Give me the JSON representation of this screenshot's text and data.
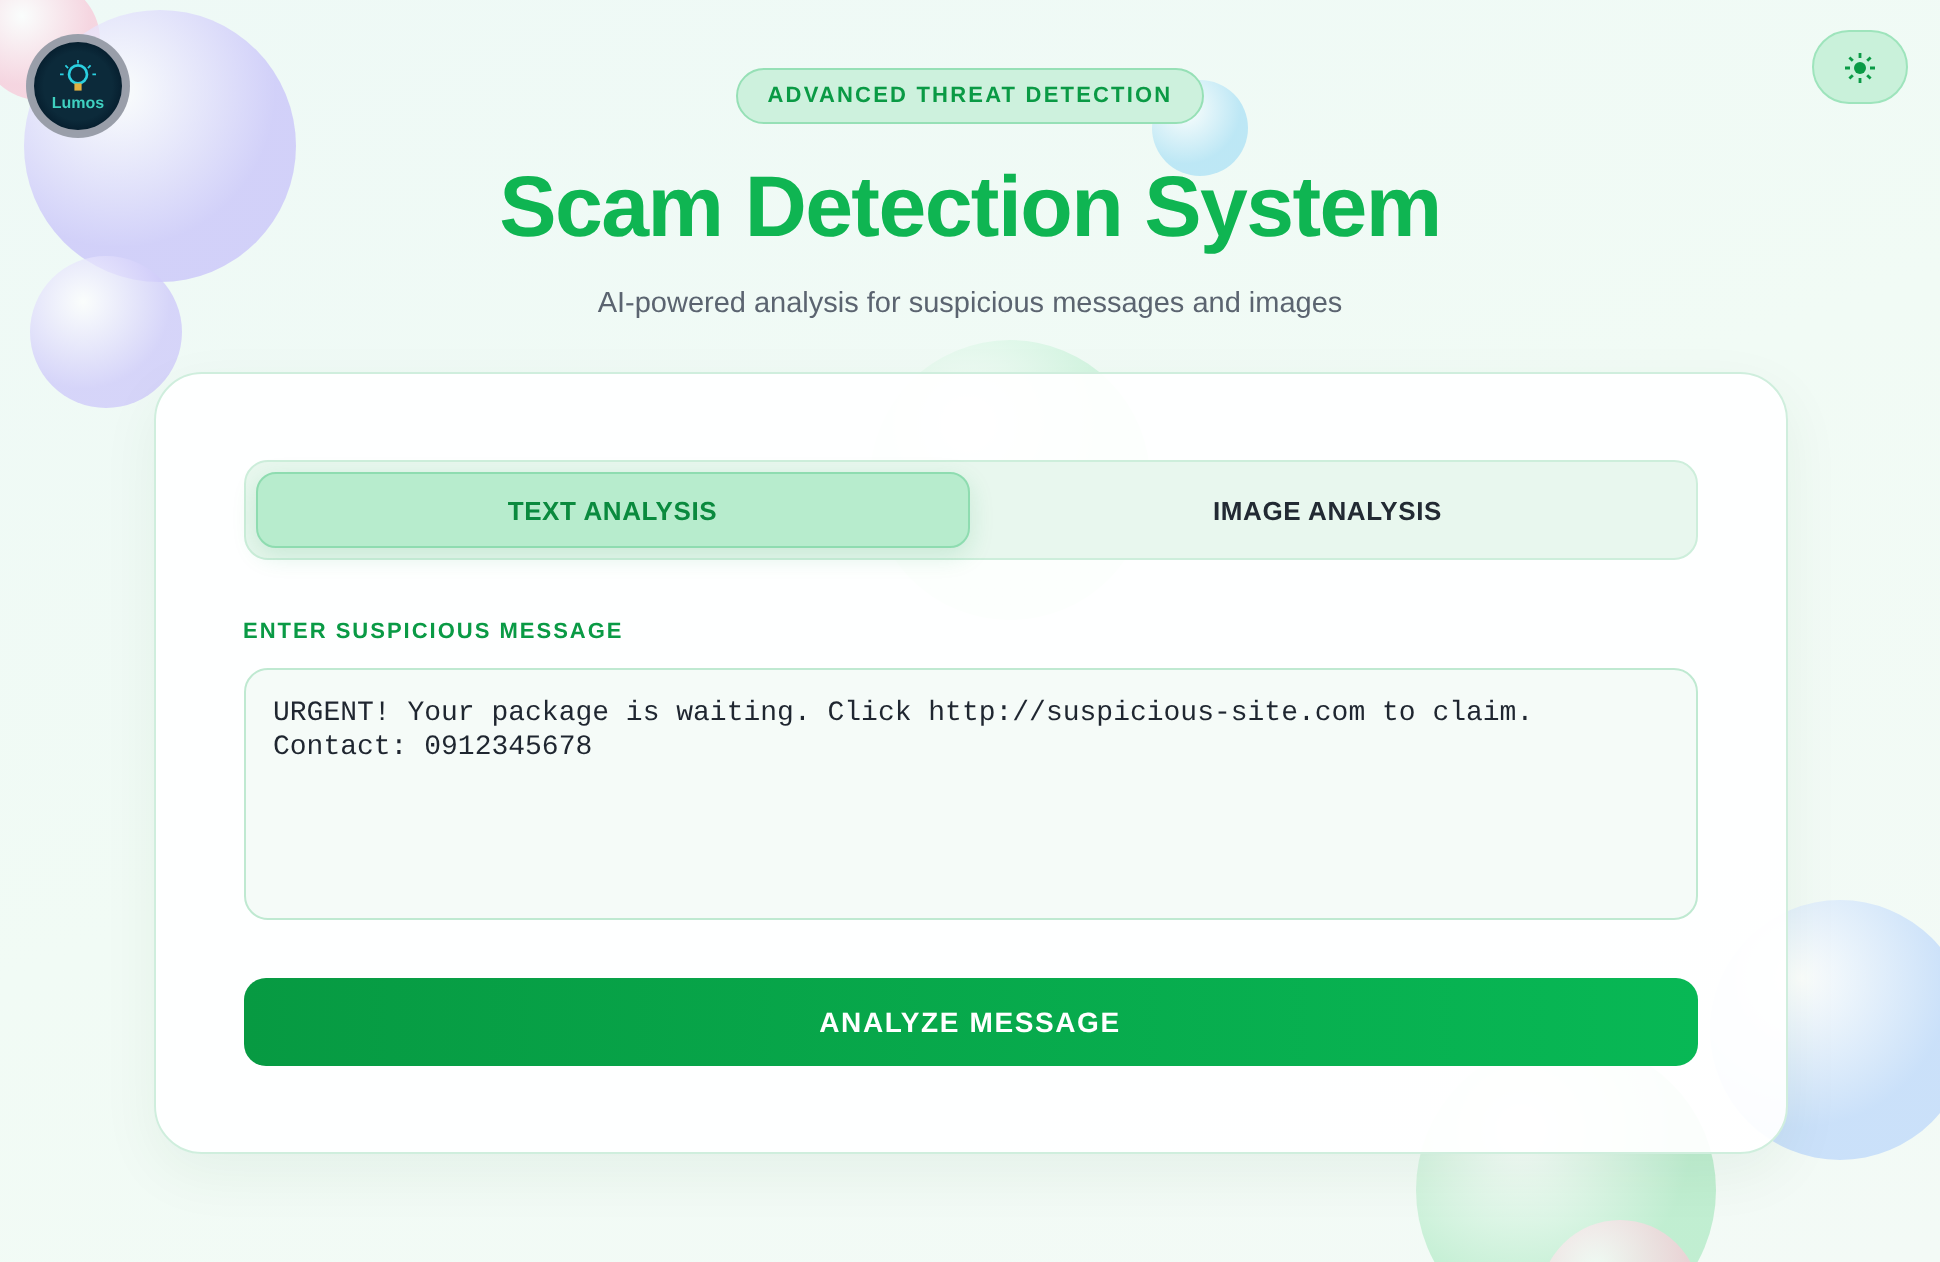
{
  "logo": {
    "text": "Lumos"
  },
  "header": {
    "badge": "ADVANCED THREAT DETECTION",
    "title": "Scam Detection System",
    "subtitle": "AI-powered analysis for suspicious messages and images"
  },
  "tabs": [
    {
      "label": "TEXT ANALYSIS",
      "selected": true
    },
    {
      "label": "IMAGE ANALYSIS",
      "selected": false
    }
  ],
  "message": {
    "label": "ENTER SUSPICIOUS MESSAGE",
    "value": "URGENT! Your package is waiting. Click http://suspicious-site.com to claim. Contact: 0912345678"
  },
  "analyze_button": "ANALYZE MESSAGE"
}
